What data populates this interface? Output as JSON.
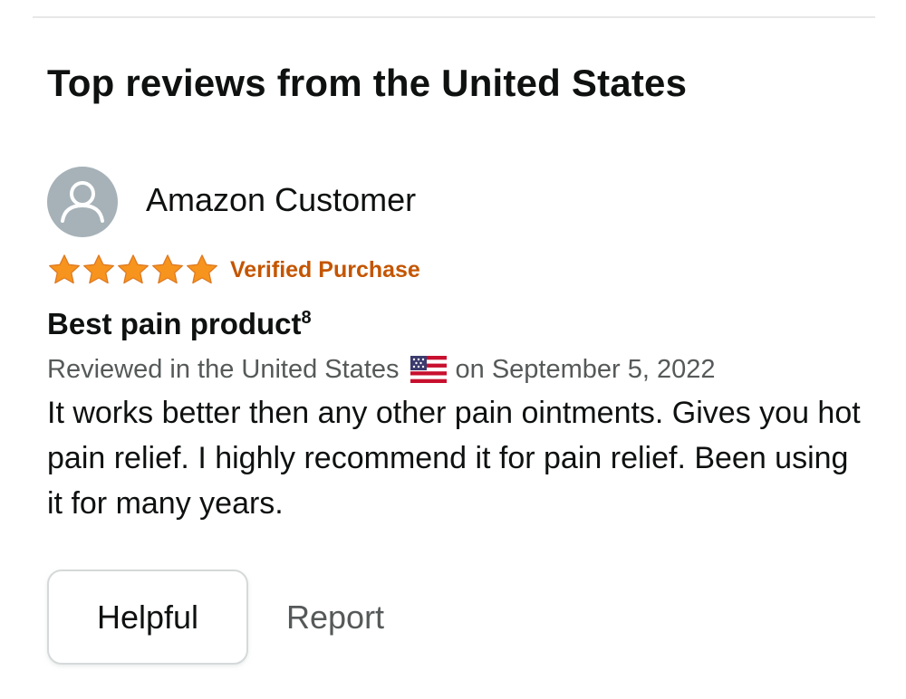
{
  "section": {
    "title": "Top reviews from the United States"
  },
  "review": {
    "reviewer_name": "Amazon Customer",
    "rating": 5,
    "rating_max": 5,
    "verified_label": "Verified Purchase",
    "title": "Best pain product",
    "title_superscript": "8",
    "meta_prefix": "Reviewed in the United States",
    "meta_suffix": "on September 5, 2022",
    "body": "It works better then any other pain ointments. Gives you hot pain relief. I highly recommend it for pain relief. Been using it for many years."
  },
  "actions": {
    "helpful_label": "Helpful",
    "report_label": "Report"
  },
  "icons": {
    "avatar": "person-silhouette-icon",
    "star": "star-icon",
    "flag": "us-flag-icon"
  },
  "colors": {
    "star": "#f7941d",
    "verified": "#c45500",
    "meta_text": "#565959",
    "avatar_bg": "#a6b2b8",
    "button_border": "#d5d9d9"
  }
}
